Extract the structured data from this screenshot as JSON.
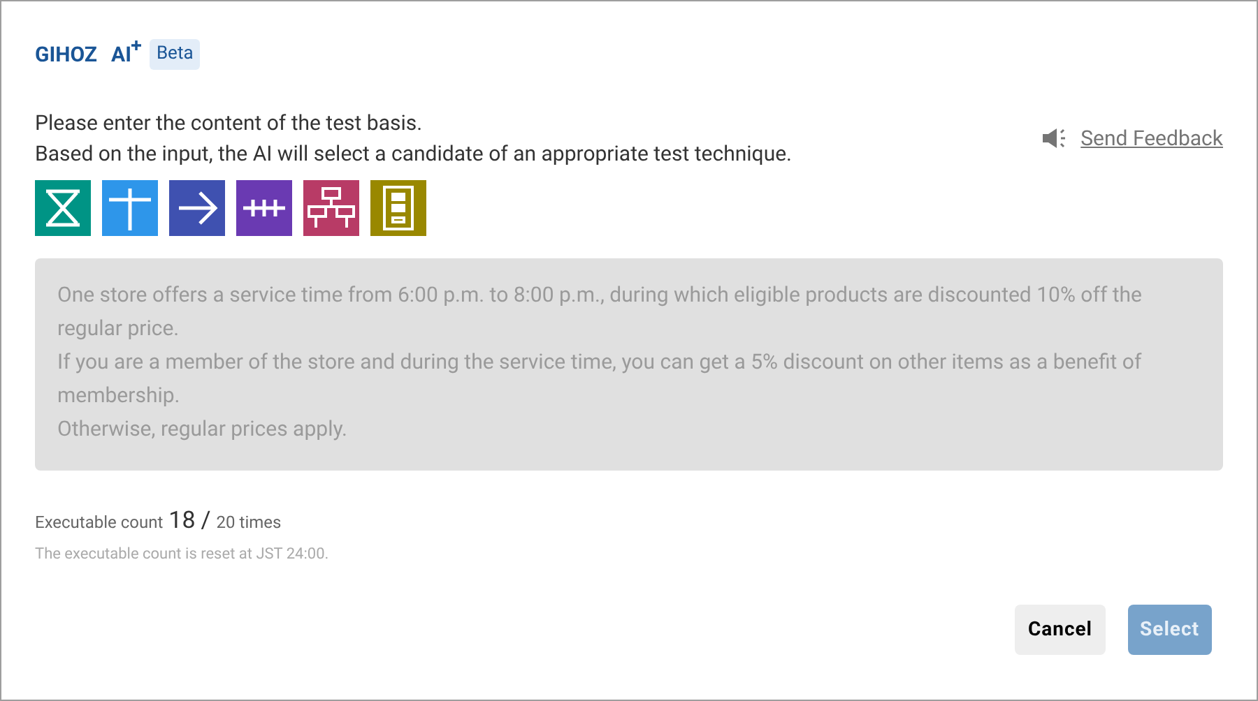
{
  "header": {
    "brand": "GIHOZ",
    "ai_label": "AI",
    "badge": "Beta"
  },
  "instructions": [
    "Please enter the content of the test basis.",
    "Based on the input, the AI will select a candidate of an appropriate test technique."
  ],
  "feedback_link": "Send Feedback",
  "techniques": [
    {
      "kind": "hourglass",
      "color": "#009485"
    },
    {
      "kind": "cross",
      "color": "#2e96ea"
    },
    {
      "kind": "arrow",
      "color": "#3f51b0"
    },
    {
      "kind": "ticks",
      "color": "#6a3ab2"
    },
    {
      "kind": "tree",
      "color": "#b83b66"
    },
    {
      "kind": "stack",
      "color": "#998800"
    }
  ],
  "test_basis": {
    "disabled": true,
    "value": "One store offers a service time from 6:00 p.m. to 8:00 p.m., during which eligible products are discounted 10% off the regular price.\nIf you are a member of the store and during the service time, you can get a 5% discount on other items as a benefit of membership.\nOtherwise, regular prices apply."
  },
  "counter": {
    "label": "Executable count",
    "current": "18",
    "separator": "/",
    "limit": "20 times",
    "note": "The executable count is reset at JST 24:00."
  },
  "buttons": [
    {
      "label": "Cancel",
      "kind": "secondary",
      "disabled": false
    },
    {
      "label": "Select",
      "kind": "primary",
      "disabled": true
    }
  ]
}
